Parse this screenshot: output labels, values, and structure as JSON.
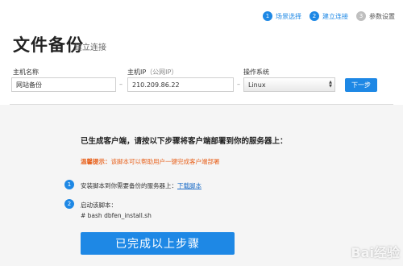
{
  "steps": [
    {
      "num": "1",
      "label": "场景选择",
      "state": "done"
    },
    {
      "num": "2",
      "label": "建立连接",
      "state": "active"
    },
    {
      "num": "3",
      "label": "参数设置",
      "state": "todo"
    }
  ],
  "page": {
    "title": "文件备份",
    "subtitle": "建立连接"
  },
  "form": {
    "host_label": "主机名称",
    "host_value": "网站备份",
    "ip_label": "主机IP",
    "ip_hint": "（公网IP）",
    "ip_value": "210.209.86.22",
    "os_label": "操作系统",
    "os_value": "Linux",
    "separator": "–",
    "next_label": "下一步"
  },
  "instructions": {
    "heading": "已生成客户端，请按以下步骤将客户端部署到你的服务器上：",
    "tip_label": "温馨提示：",
    "tip_text": "该脚本可以帮助用户一键完成客户端部署",
    "step1_num": "1",
    "step1_text": "安装脚本到你需要备份的服务器上：",
    "step1_link": "下载脚本",
    "step2_num": "2",
    "step2_text": "启动该脚本：",
    "step2_cmd": "# bash dbfen_install.sh",
    "done_label": "已完成以上步骤"
  },
  "watermark": "Bai经验"
}
